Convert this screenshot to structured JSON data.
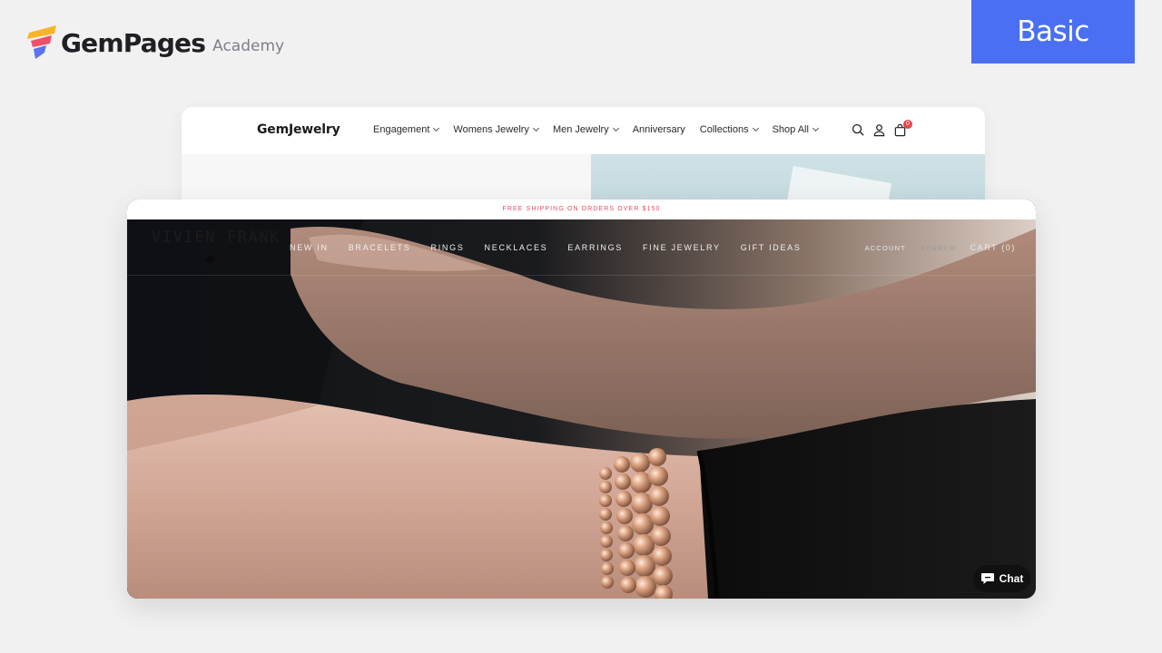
{
  "gempages": {
    "brand": "GemPages",
    "sub": "Academy",
    "badge": "Basic",
    "colors": {
      "badge": "#4a6ff2",
      "brand_text": "#1f1f24"
    }
  },
  "gemjewelry": {
    "brand": "GemJewelry",
    "menu": [
      {
        "label": "Engagement",
        "dropdown": true
      },
      {
        "label": "Womens Jewelry",
        "dropdown": true
      },
      {
        "label": "Men Jewelry",
        "dropdown": true
      },
      {
        "label": "Anniversary",
        "dropdown": false
      },
      {
        "label": "Collections",
        "dropdown": true
      },
      {
        "label": "Shop All",
        "dropdown": true
      }
    ],
    "icons": [
      "search-icon",
      "user-icon",
      "cart-icon"
    ],
    "cart_count": "0"
  },
  "vivien": {
    "promo": "FREE SHIPPING ON ORDERS OVER $150",
    "logo": "VIVIEN FRANK",
    "menu": [
      "NEW IN",
      "BRACELETS",
      "RINGS",
      "NECKLACES",
      "EARRINGS",
      "FINE JEWELRY",
      "GIFT IDEAS"
    ],
    "account": "ACCOUNT",
    "search": "SEARCH",
    "cart": "CART (0)",
    "chat": "Chat",
    "colors": {
      "promo": "#e24c6b"
    }
  }
}
